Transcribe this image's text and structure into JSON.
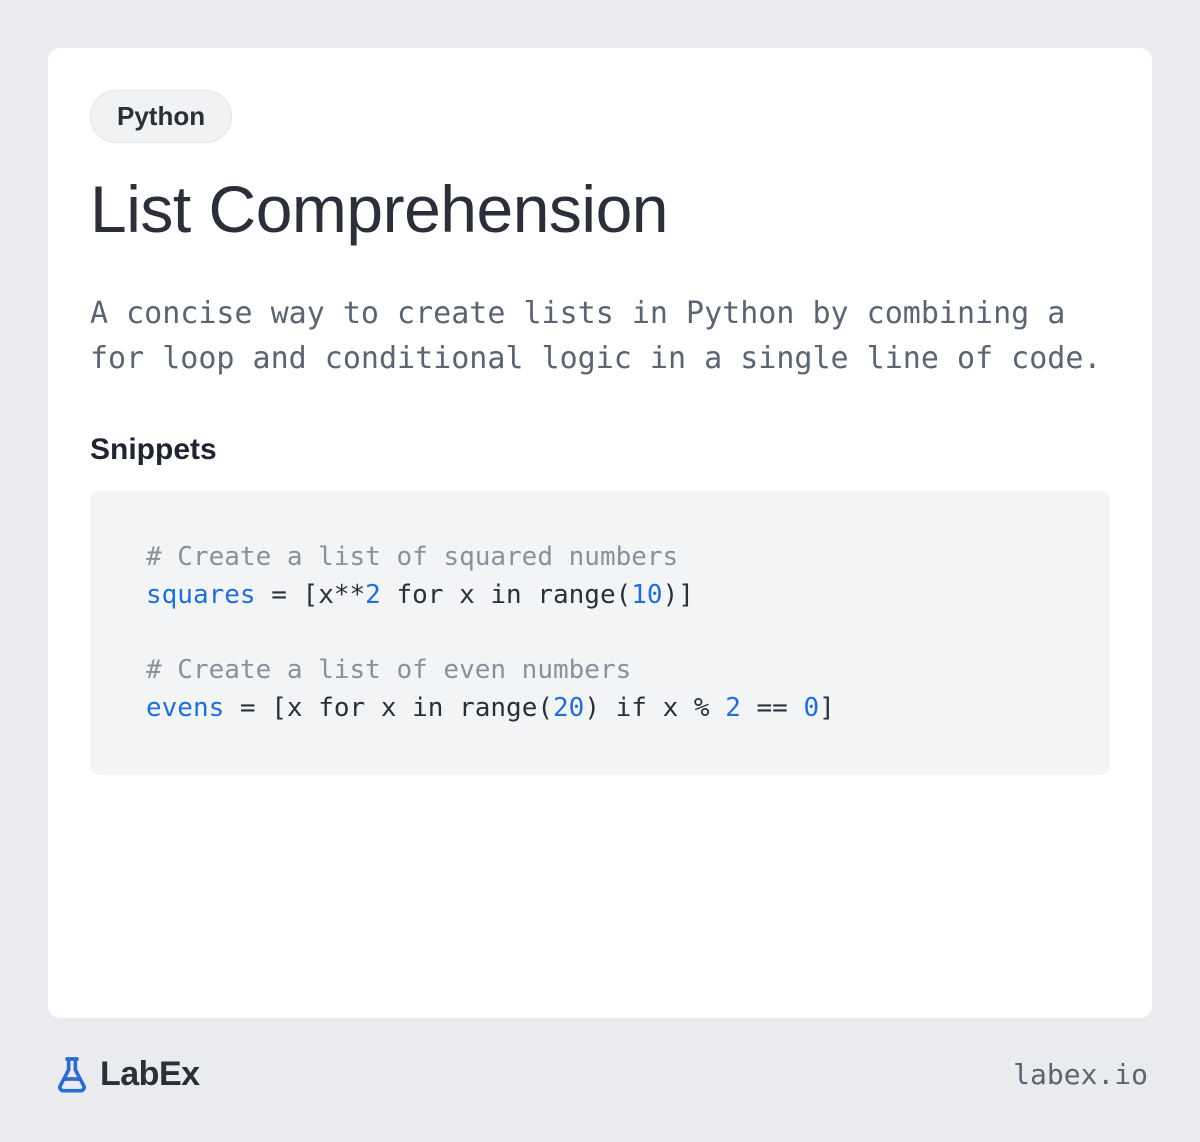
{
  "tag": "Python",
  "title": "List Comprehension",
  "description": "A concise way to create lists in Python by combining a for loop and conditional logic in a single line of code.",
  "section_heading": "Snippets",
  "code": {
    "line1_comment": "# Create a list of squared numbers",
    "line2_var": "squares",
    "line2_rest_a": " = [x**",
    "line2_num_a": "2",
    "line2_rest_b": " for x in range(",
    "line2_num_b": "10",
    "line2_rest_c": ")]",
    "line4_comment": "# Create a list of even numbers",
    "line5_var": "evens",
    "line5_rest_a": " = [x for x in range(",
    "line5_num_a": "20",
    "line5_rest_b": ") if x % ",
    "line5_num_b": "2",
    "line5_rest_c": " == ",
    "line5_num_c": "0",
    "line5_rest_d": "]"
  },
  "footer": {
    "logo_text": "LabEx",
    "url": "labex.io"
  }
}
